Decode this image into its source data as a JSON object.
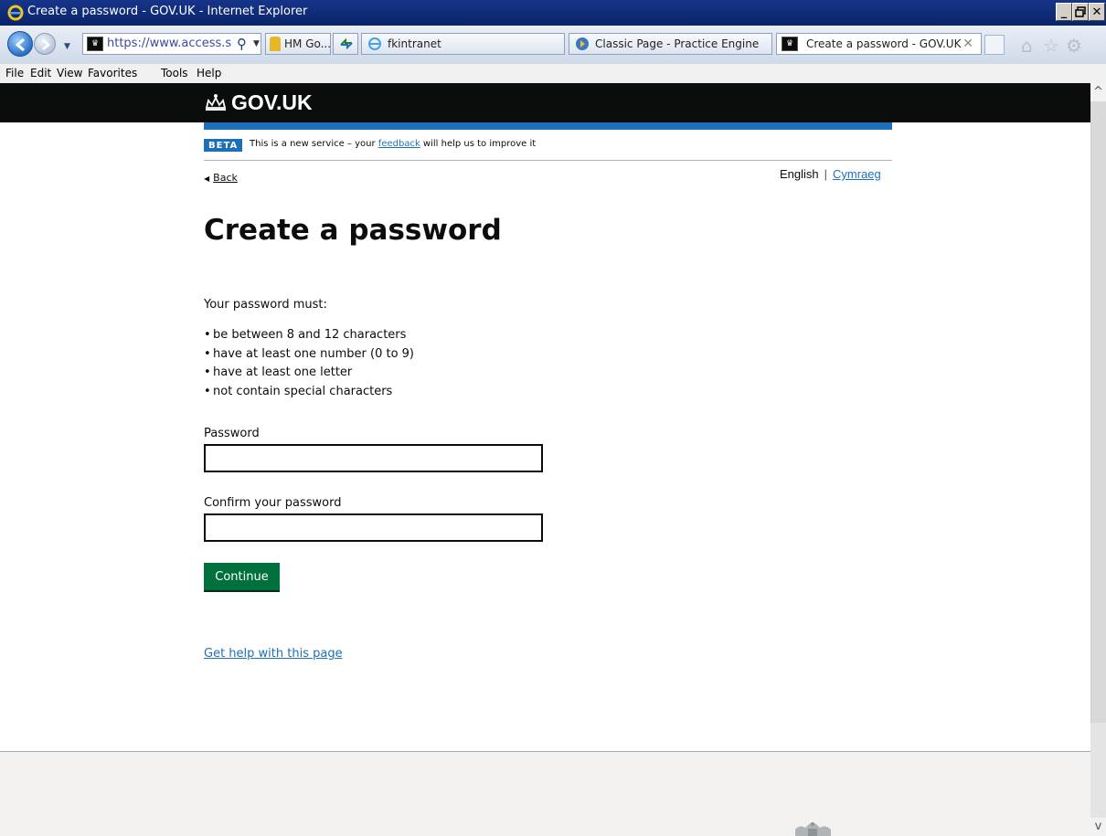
{
  "window": {
    "title": "Create a password - GOV.UK - Internet Explorer",
    "min": "_",
    "max": "□",
    "close": "✕"
  },
  "navbar": {
    "address_url": "https://www.access.s",
    "tabs": [
      {
        "label": "HM Go...",
        "active": false
      },
      {
        "label": "fkintranet",
        "active": false
      },
      {
        "label": "Classic Page - Practice Engine",
        "active": false
      },
      {
        "label": "Create a password - GOV.UK",
        "active": true
      }
    ],
    "icons": [
      "back-icon",
      "forward-icon",
      "search-icon",
      "lock-icon",
      "compatibility-icon",
      "ie-icon",
      "home-icon",
      "favorites-star-icon",
      "tools-gear-icon"
    ]
  },
  "menubar": {
    "items": [
      "File",
      "Edit",
      "View",
      "Favorites",
      "Tools",
      "Help"
    ]
  },
  "page": {
    "brand": "GOV.UK",
    "beta_tag": "BETA",
    "beta_text_before": "This is a new service – your",
    "beta_link": "feedback",
    "beta_text_after": "will help us to improve it",
    "back_link": "Back",
    "lang_english": "English",
    "lang_sep": "|",
    "lang_welsh": "Cymraeg",
    "title": "Create a password",
    "intro": "Your password must:",
    "requirements": [
      "be between 8 and 12 characters",
      "have at least one number (0 to 9)",
      "have at least one letter",
      "not contain special characters"
    ],
    "password_label": "Password",
    "password_value": "",
    "confirm_label": "Confirm your password",
    "confirm_value": "",
    "continue_button": "Continue",
    "help_link": "Get help with this page"
  },
  "colors": {
    "header_bg": "#0b0c0c",
    "accent_blue": "#1d70b8",
    "button_green": "#00703c",
    "footer_bg": "#f3f2f1"
  }
}
